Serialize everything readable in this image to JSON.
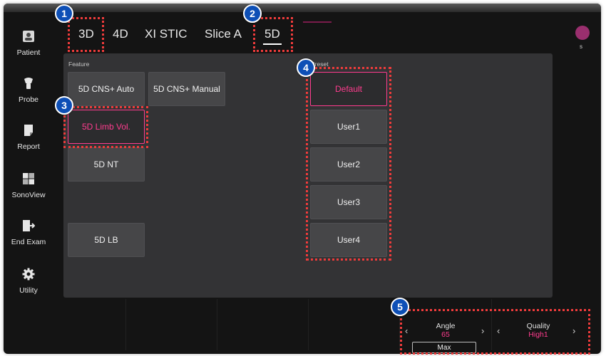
{
  "sidebar": {
    "items": [
      {
        "label": "Patient",
        "icon": "patient-icon"
      },
      {
        "label": "Probe",
        "icon": "probe-icon"
      },
      {
        "label": "Report",
        "icon": "report-icon"
      },
      {
        "label": "SonoView",
        "icon": "sonoview-icon"
      },
      {
        "label": "End Exam",
        "icon": "end-exam-icon"
      },
      {
        "label": "Utility",
        "icon": "gear-icon"
      }
    ]
  },
  "tabs": [
    {
      "label": "3D"
    },
    {
      "label": "4D"
    },
    {
      "label": "XI STIC"
    },
    {
      "label": "Slice A"
    },
    {
      "label": "5D",
      "active": true
    }
  ],
  "user": {
    "avatar_label": "s",
    "avatar_color": "#9a2f6e"
  },
  "feature": {
    "section_label": "Feature",
    "buttons": [
      {
        "label": "5D CNS+ Auto"
      },
      {
        "label": "5D CNS+ Manual"
      },
      {
        "label": "5D Limb Vol.",
        "selected": true
      },
      {
        "label": "5D NT"
      },
      {
        "label": "5D LB"
      }
    ]
  },
  "preset": {
    "section_label": "Preset",
    "buttons": [
      {
        "label": "Default",
        "selected": true
      },
      {
        "label": "User1"
      },
      {
        "label": "User2"
      },
      {
        "label": "User3"
      },
      {
        "label": "User4"
      }
    ]
  },
  "controls": {
    "angle": {
      "title": "Angle",
      "value": "65",
      "button": "Max"
    },
    "quality": {
      "title": "Quality",
      "value": "High1"
    }
  },
  "annotations": [
    {
      "number": "1"
    },
    {
      "number": "2"
    },
    {
      "number": "3"
    },
    {
      "number": "4"
    },
    {
      "number": "5"
    }
  ],
  "colors": {
    "accent_pink": "#ff3c8e",
    "annotation_red": "#ee3b3b",
    "badge_blue": "#0d4fb6"
  }
}
